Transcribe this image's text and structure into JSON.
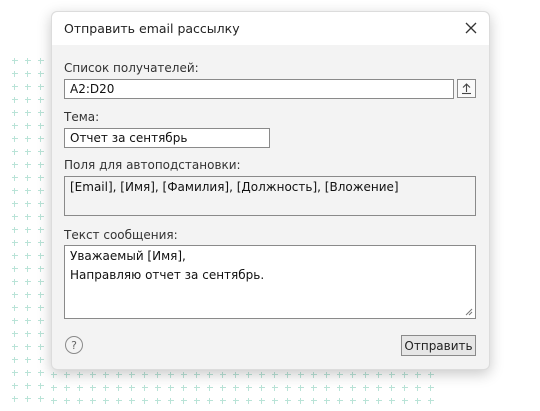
{
  "dialog": {
    "title": "Отправить email рассылку",
    "recipients": {
      "label": "Список получателей:",
      "value": "A2:D20"
    },
    "subject": {
      "label": "Тема:",
      "value": "Отчет за сентябрь"
    },
    "fields": {
      "label": "Поля для автоподстановки:",
      "value": "[Email], [Имя], [Фамилия], [Должность], [Вложение]"
    },
    "message": {
      "label": "Текст сообщения:",
      "lines": [
        "Уважаемый [Имя],",
        "",
        "Направляю отчет за сентябрь."
      ]
    },
    "help_glyph": "?",
    "send_label": "Отправить"
  },
  "icons": {
    "close": "close-icon",
    "upload": "upload-icon",
    "resize": "resize-grip-icon",
    "help": "help-icon"
  },
  "colors": {
    "background_pattern": "#b9e3d7",
    "dialog_bg": "#f3f3f3",
    "border": "#8a8a8a"
  }
}
